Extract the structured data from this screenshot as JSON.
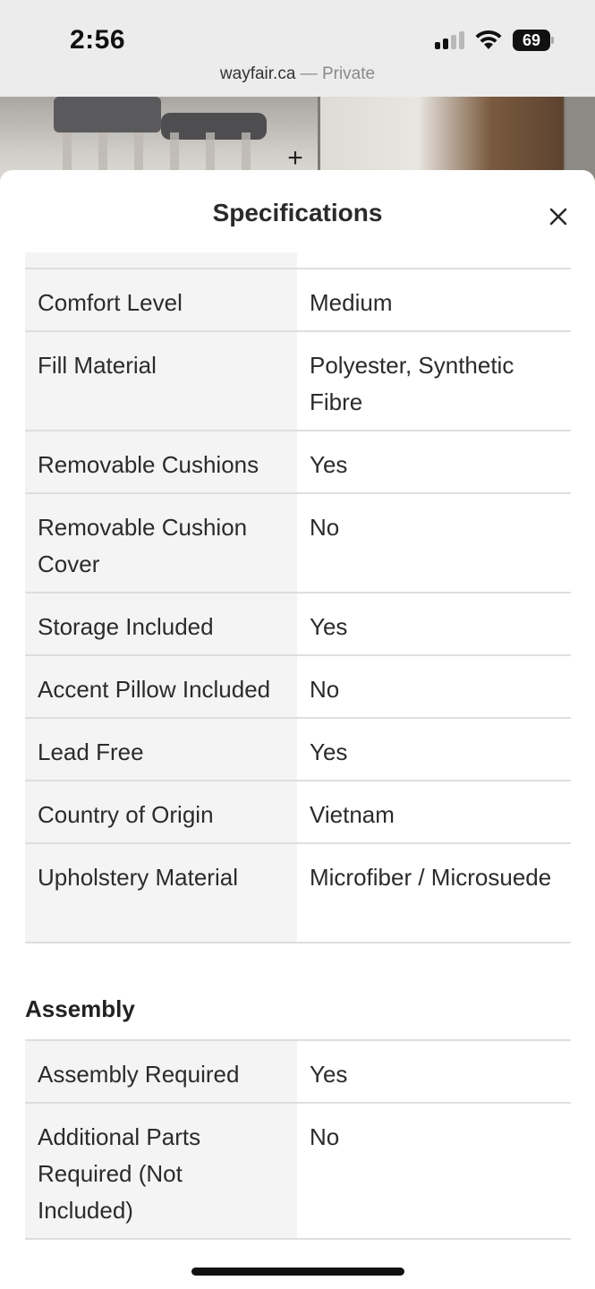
{
  "status_bar": {
    "time": "2:56",
    "battery": "69"
  },
  "browser": {
    "domain": "wayfair.ca",
    "separator": "—",
    "mode": "Private"
  },
  "background": {
    "add_icon": "plus-icon"
  },
  "sheet": {
    "title": "Specifications",
    "close_icon": "close-icon"
  },
  "specs": [
    {
      "label": "Comfort Level",
      "value": "Medium"
    },
    {
      "label": "Fill Material",
      "value": "Polyester, Synthetic Fibre"
    },
    {
      "label": "Removable Cushions",
      "value": "Yes"
    },
    {
      "label": "Removable Cushion Cover",
      "value": "No"
    },
    {
      "label": "Storage Included",
      "value": "Yes"
    },
    {
      "label": "Accent Pillow Included",
      "value": "No"
    },
    {
      "label": "Lead Free",
      "value": "Yes"
    },
    {
      "label": "Country of Origin",
      "value": "Vietnam"
    },
    {
      "label": "Upholstery Material",
      "value": "Microfiber / Microsuede"
    }
  ],
  "assembly": {
    "title": "Assembly",
    "rows": [
      {
        "label": "Assembly Required",
        "value": "Yes"
      },
      {
        "label": "Additional Parts Required (Not Included)",
        "value": "No"
      }
    ]
  }
}
